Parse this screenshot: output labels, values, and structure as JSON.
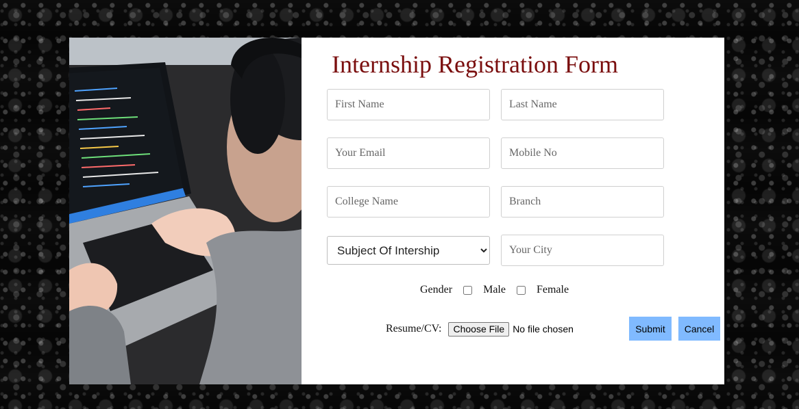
{
  "form": {
    "title": "Internship Registration Form",
    "first_name_placeholder": "First Name",
    "last_name_placeholder": "Last Name",
    "email_placeholder": "Your Email",
    "mobile_placeholder": "Mobile No",
    "college_placeholder": "College Name",
    "branch_placeholder": "Branch",
    "subject_selected": "Subject Of Intership",
    "city_placeholder": "Your City",
    "gender_label": "Gender",
    "gender_options": [
      "Male",
      "Female"
    ],
    "resume_label": "Resume/CV:",
    "file_button_label": "Choose File",
    "file_status": "No file chosen",
    "submit_label": "Submit",
    "cancel_label": "Cancel"
  },
  "colors": {
    "title": "#7a0e0e",
    "button": "#80baff",
    "card": "#ffffff"
  },
  "image": {
    "subject": "person coding on laptop"
  }
}
